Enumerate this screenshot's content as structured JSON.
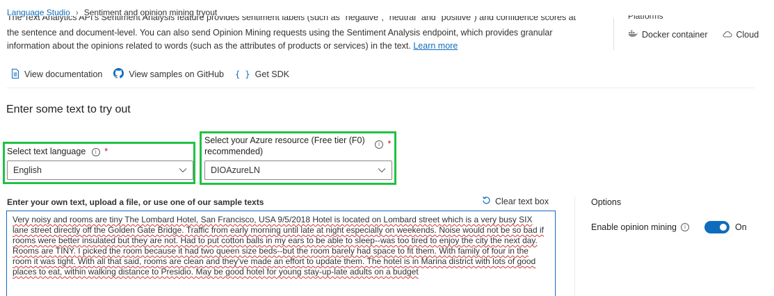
{
  "breadcrumb": {
    "root": "Language Studio",
    "current": "Sentiment and opinion mining tryout"
  },
  "description": {
    "clipped_line": "The Text Analytics API's Sentiment Analysis feature provides sentiment labels (such as \"negative\", \"neutral\" and \"positive\") and confidence scores at",
    "body": "the sentence and document-level. You can also send Opinion Mining requests using the Sentiment Analysis endpoint, which provides granular information about the opinions related to words (such as the attributes of products or services) in the text.",
    "learn_more": "Learn more"
  },
  "platforms": {
    "clipped_heading": "Platforms",
    "items": [
      {
        "label": "Docker container",
        "icon": "docker-icon"
      },
      {
        "label": "Cloud",
        "icon": "cloud-icon"
      }
    ]
  },
  "links": {
    "documentation": "View documentation",
    "github": "View samples on GitHub",
    "sdk": "Get SDK"
  },
  "section_title": "Enter some text to try out",
  "language": {
    "label": "Select text language",
    "required_mark": "*",
    "value": "English"
  },
  "resource": {
    "label": "Select your Azure resource (Free tier (F0) recommended)",
    "required_mark": "*",
    "value": "DIOAzureLN"
  },
  "textbox": {
    "label": "Enter your own text, upload a file, or use one of our sample texts",
    "clear_label": "Clear text box",
    "value": "Very noisy and rooms are tiny The Lombard Hotel, San Francisco, USA 9/5/2018 Hotel is located on Lombard street which is a very busy SIX lane street directly off the Golden Gate Bridge. Traffic from early morning until late at night especially on weekends. Noise would not be so bad if rooms were better insulated but they are not. Had to put cotton balls in my ears to be able to sleep--was too tired to enjoy the city the next day. Rooms are TINY. I picked the room because it had two queen size beds--but the room barely had space to fit them. With family of four in the room it was tight. With all that said, rooms are clean and they've made an effort to update them. The hotel is in Marina district with lots of good places to eat, within walking distance to Presidio. May be good hotel for young stay-up-late adults on a budget"
  },
  "options": {
    "title": "Options",
    "opinion_label": "Enable opinion mining",
    "toggle_state": "On"
  },
  "colors": {
    "accent": "#0f6cbd",
    "highlight": "#21c144",
    "required": "#c50f1f"
  }
}
